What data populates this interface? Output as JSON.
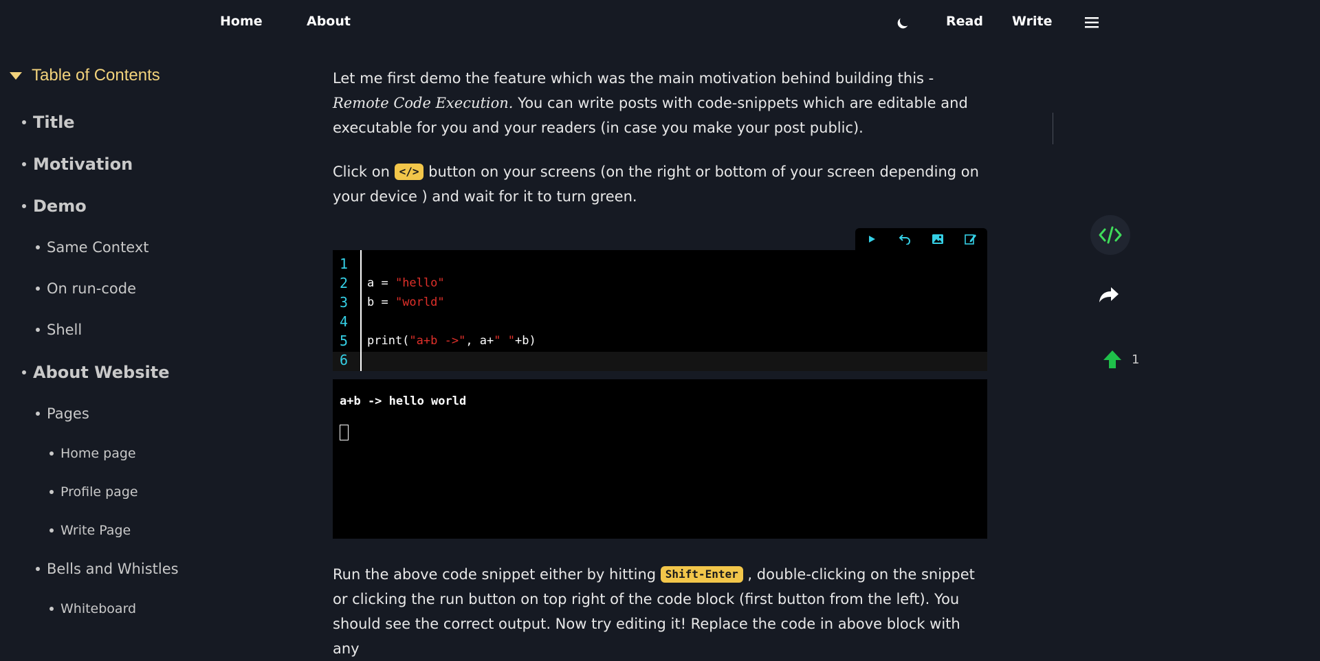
{
  "nav": {
    "home": "Home",
    "about": "About",
    "read": "Read",
    "write": "Write",
    "theme_icon": "moon-icon",
    "menu_icon": "hamburger-menu-icon"
  },
  "toc": {
    "title": "Table of Contents",
    "items": [
      {
        "label": "Title"
      },
      {
        "label": "Motivation"
      },
      {
        "label": "Demo"
      },
      {
        "label": "Same Context"
      },
      {
        "label": "On run-code"
      },
      {
        "label": "Shell"
      },
      {
        "label": "About Website"
      },
      {
        "label": "Pages"
      },
      {
        "label": "Home page"
      },
      {
        "label": "Profile page"
      },
      {
        "label": "Write Page"
      },
      {
        "label": "Bells and Whistles"
      },
      {
        "label": "Whiteboard"
      }
    ]
  },
  "article": {
    "p1_a": "Let me first demo the feature which was the main motivation behind building this -",
    "p1_em": "Remote Code Execution.",
    "p1_b": " You can write posts with code-snippets which are editable and executable for you and your readers (in case you make your post public).",
    "p2_a": "Click on ",
    "p2_pill": "</>",
    "p2_b": " button on your screens (on the right or bottom of your screen depending on your device ) and wait for it to turn green.",
    "p3_a": "Run the above code snippet either by hitting ",
    "p3_pill": "Shift-Enter",
    "p3_b": " , double-clicking on the snippet or clicking the run button on top right of the code block (first button from the left). You should see the correct output. Now try editing it! Replace the code in above block with any"
  },
  "code": {
    "line_numbers": [
      "1",
      "2",
      "3",
      "4",
      "5",
      "6"
    ],
    "l2_var": "a = ",
    "l2_str": "\"hello\"",
    "l3_var": "b = ",
    "l3_str": "\"world\"",
    "l5_a": "print(",
    "l5_str1": "\"a+b ->\"",
    "l5_b": ", a+",
    "l5_str2": "\" \"",
    "l5_c": "+b)",
    "output": "a+b -> hello world"
  },
  "toolbar": {
    "icons": [
      "play-icon",
      "undo-icon",
      "image-icon",
      "edit-icon"
    ]
  },
  "rail": {
    "upvote_count": "1"
  },
  "colors": {
    "background": "#161a23",
    "accent_yellow": "#f2d37c",
    "code_green": "#3fdc5a",
    "line_number_cyan": "#35d0e6",
    "string_red": "#e0302a",
    "upvote_green": "#1fbf4a"
  }
}
